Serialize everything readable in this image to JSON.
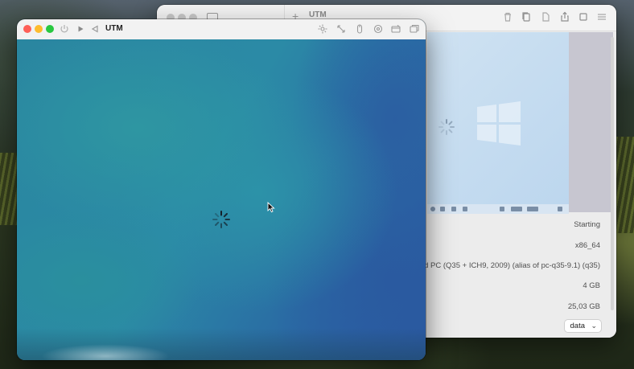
{
  "back_window": {
    "title": "UTM",
    "status": "Starting",
    "architecture": "x86_64",
    "machine": "ndard PC (Q35 + ICH9, 2009) (alias of pc-q35-9.1) (q35)",
    "memory": "4 GB",
    "size": "25,03 GB",
    "shared_dir_select": "data"
  },
  "front_window": {
    "title": "UTM"
  },
  "colors": {
    "close": "#fe5f57",
    "minimize": "#febc2e",
    "zoom": "#28c840"
  }
}
